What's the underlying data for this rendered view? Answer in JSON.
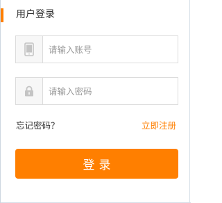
{
  "header": {
    "title": "用户登录"
  },
  "form": {
    "account": {
      "placeholder": "请输入账号",
      "value": "",
      "icon": "phone-icon"
    },
    "password": {
      "placeholder": "请输入密码",
      "value": "",
      "icon": "lock-icon"
    },
    "forgot_label": "忘记密码？",
    "register_label": "立即注册",
    "login_label": "登录"
  },
  "colors": {
    "accent": "#ff7f00",
    "text": "#333333",
    "placeholder": "#9a9a9a",
    "border": "#dcdcdc",
    "icon_bg": "#f7f7f7"
  }
}
